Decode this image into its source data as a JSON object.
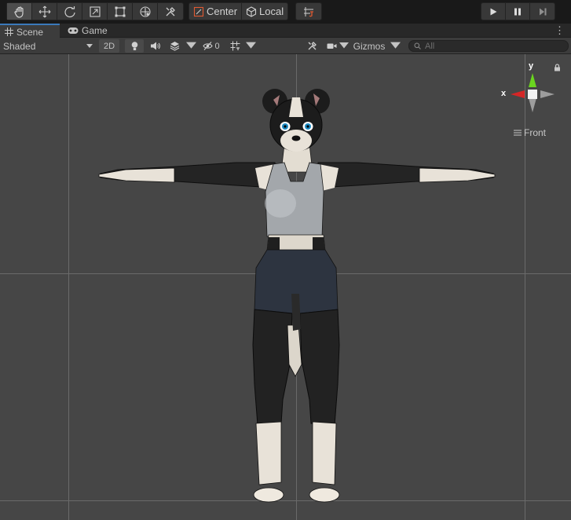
{
  "toolbar": {
    "tools": [
      {
        "name": "hand-tool",
        "icon": "hand-icon",
        "active": true
      },
      {
        "name": "move-tool",
        "icon": "move-arrows-icon",
        "active": false
      },
      {
        "name": "rotate-tool",
        "icon": "rotate-icon",
        "active": false
      },
      {
        "name": "scale-tool",
        "icon": "scale-icon",
        "active": false
      },
      {
        "name": "rect-tool",
        "icon": "rect-transform-icon",
        "active": false
      },
      {
        "name": "transform-tool",
        "icon": "transform-icon",
        "active": false
      },
      {
        "name": "custom-tool",
        "icon": "tools-icon",
        "active": false
      }
    ],
    "pivot_mode": "Center",
    "pivot_rotation": "Local",
    "snap_icon": "grid-snap-icon",
    "play_icon": "play-icon",
    "pause_icon": "pause-icon",
    "step_icon": "step-icon"
  },
  "tabs": [
    {
      "label": "Scene",
      "icon": "grid-icon",
      "active": true
    },
    {
      "label": "Game",
      "icon": "gamepad-icon",
      "active": false
    }
  ],
  "scene_controls": {
    "draw_mode": "Shaded",
    "mode_2d": "2D",
    "hidden_count": "0",
    "gizmos_label": "Gizmos",
    "search_placeholder": "All"
  },
  "view_gizmo": {
    "y_label": "y",
    "x_label": "x",
    "view_name": "Front"
  },
  "colors": {
    "accent": "#3a79bb",
    "viewport_bg": "#464646",
    "toolbar_bg": "#191919",
    "axis_x": "#d42626",
    "axis_y": "#6bd61f"
  }
}
